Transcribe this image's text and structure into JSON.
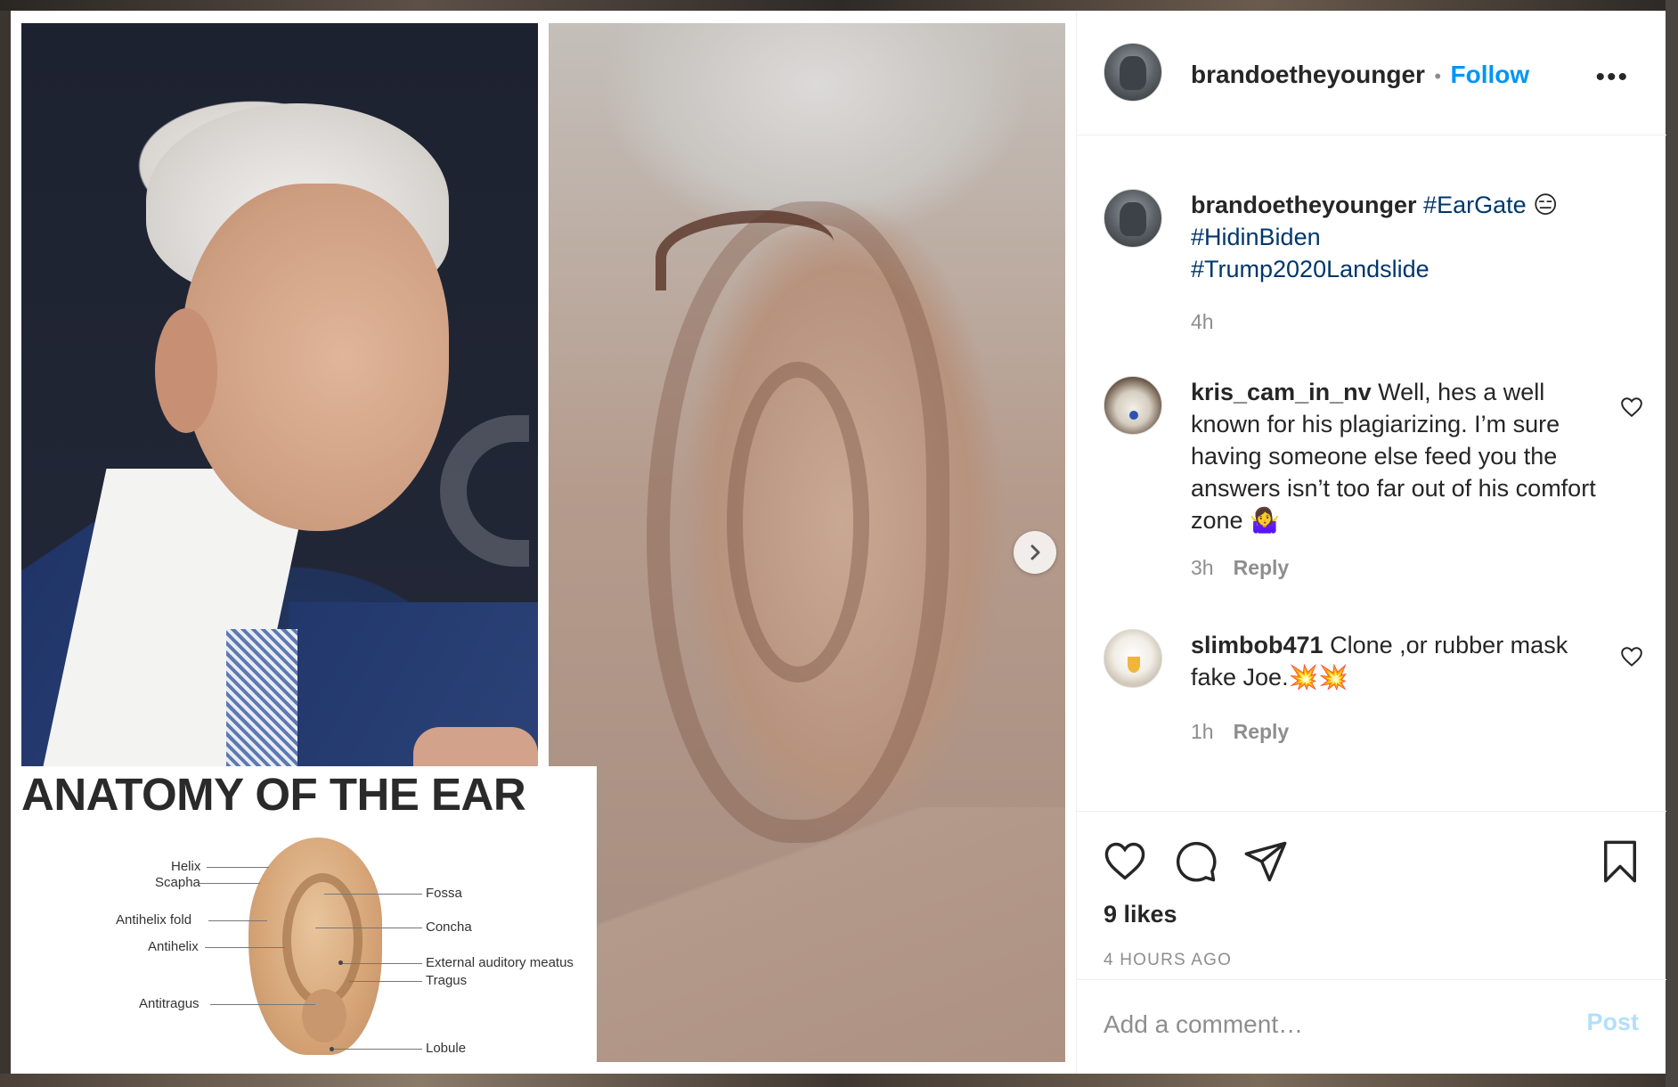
{
  "post": {
    "media": {
      "anatomy_title": "ANATOMY OF THE EAR",
      "anatomy_labels": {
        "helix": "Helix",
        "scapha": "Scapha",
        "antihelix_fold": "Antihelix fold",
        "antihelix": "Antihelix",
        "antitragus": "Antitragus",
        "fossa": "Fossa",
        "concha": "Concha",
        "meatus": "External auditory meatus",
        "tragus": "Tragus",
        "lobule": "Lobule"
      },
      "next_icon": "chevron-right-icon"
    },
    "header": {
      "username": "brandoetheyounger",
      "separator": "•",
      "follow_label": "Follow",
      "more_label": "•••"
    },
    "caption": {
      "username": "brandoetheyounger",
      "hashtag1": "#EarGate",
      "emoji1": "😑",
      "hashtag2": "#HidinBiden",
      "hashtag3": "#Trump2020Landslide",
      "time": "4h"
    },
    "comments": [
      {
        "username": "kris_cam_in_nv",
        "text": "Well, hes a well known for his plagiarizing. I’m sure having someone else feed you the answers isn’t too far out of his comfort zone 🤷‍♀️",
        "time": "3h",
        "reply_label": "Reply"
      },
      {
        "username": "slimbob471",
        "text": "Clone ,or rubber mask fake Joe.💥💥",
        "time": "1h",
        "reply_label": "Reply"
      }
    ],
    "likes": "9 likes",
    "time_ago": "4 HOURS AGO",
    "comment_box": {
      "placeholder": "Add a comment…",
      "post_label": "Post"
    },
    "icons": [
      "heart-icon",
      "comment-icon",
      "share-icon",
      "bookmark-icon"
    ]
  }
}
